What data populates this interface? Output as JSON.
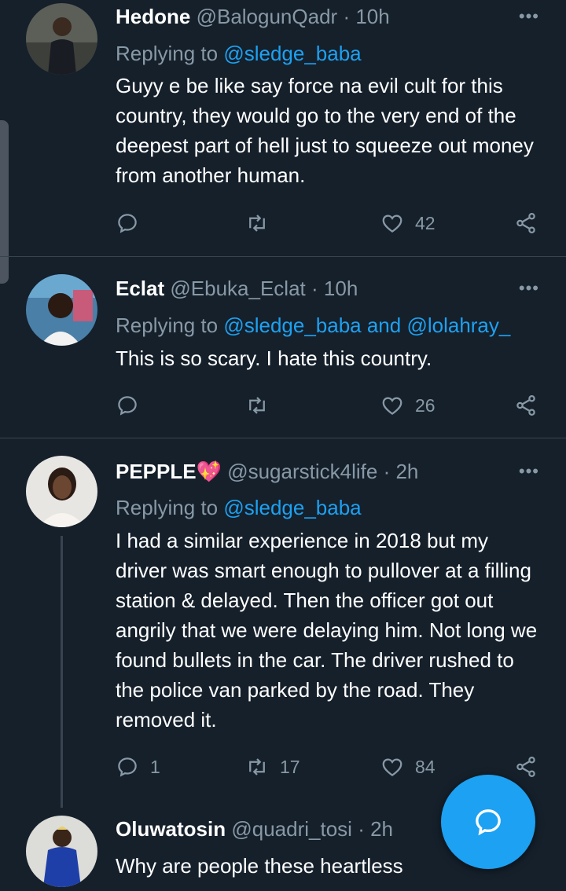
{
  "tweets": [
    {
      "name": "Hedone",
      "handle": "@BalogunQadr",
      "time": "· 10h",
      "replying_prefix": "Replying to ",
      "replying_to": "@sledge_baba",
      "text": "Guyy e be like say force na evil cult for this country, they would go to the very end of the deepest part of hell just to squeeze out money from another human.",
      "replies": "",
      "retweets": "",
      "likes": "42"
    },
    {
      "name": "Eclat",
      "handle": "@Ebuka_Eclat",
      "time": "· 10h",
      "replying_prefix": "Replying to ",
      "replying_to": "@sledge_baba and @lolahray_",
      "text": "This is so scary. I hate this country.",
      "replies": "",
      "retweets": "",
      "likes": "26"
    },
    {
      "name": "PEPPLE💖",
      "handle": "@sugarstick4life",
      "time": "· 2h",
      "replying_prefix": "Replying to ",
      "replying_to": "@sledge_baba",
      "text": "I had a similar experience in 2018 but my driver was smart enough to pullover at a filling station & delayed. Then the officer got out angrily that we were delaying him. Not long we found bullets in the car. The driver rushed to the police van parked by the road. They removed it.",
      "replies": "1",
      "retweets": "17",
      "likes": "84"
    },
    {
      "name": "Oluwatosin",
      "handle": "@quadri_tosi",
      "time": "· 2h",
      "text": "Why are people these heartless"
    }
  ],
  "more_label": "•••",
  "colors": {
    "background": "#15202b",
    "accent": "#1da1f2",
    "muted": "#8899a6",
    "divider": "#38444d"
  },
  "icons": {
    "reply": "reply-icon",
    "retweet": "retweet-icon",
    "like": "heart-icon",
    "share": "share-icon",
    "compose": "compose-reply-icon"
  }
}
